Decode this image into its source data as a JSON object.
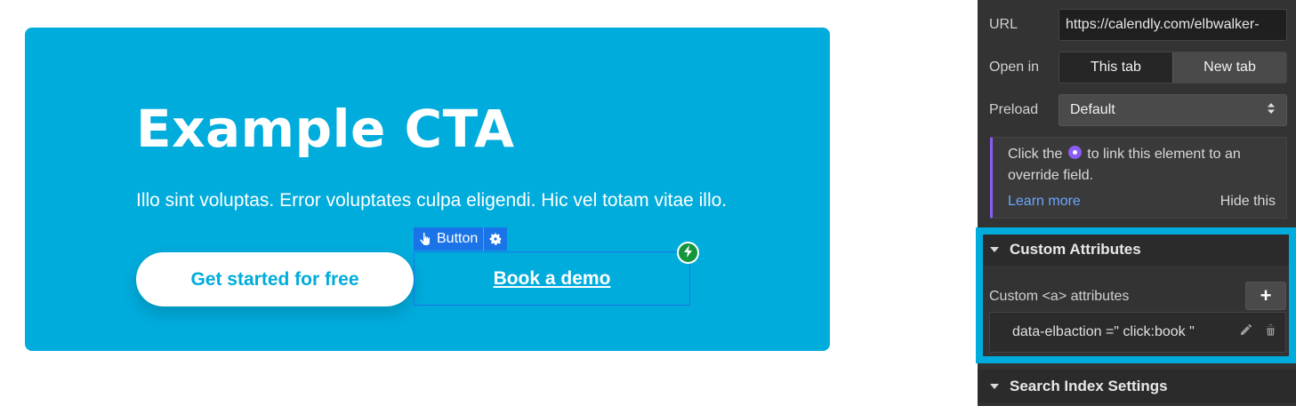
{
  "canvas": {
    "title": "Example CTA",
    "text": "Illo sint voluptas. Error voluptates culpa eligendi. Hic vel totam vitae illo.",
    "primary_button": "Get started for free",
    "link_button": "Book a demo",
    "selection_label": "Button",
    "colors": {
      "cta_bg": "#00acdc",
      "selection": "#1a74e8",
      "badge": "#14963c"
    }
  },
  "panel": {
    "url_label": "URL",
    "url_value": "https://calendly.com/elbwalker-",
    "open_in_label": "Open in",
    "open_in_options": [
      "This tab",
      "New tab"
    ],
    "open_in_selected": "This tab",
    "preload_label": "Preload",
    "preload_value": "Default",
    "notice_before": "Click the",
    "notice_after": "to link this element to an override field.",
    "notice_learn": "Learn more",
    "notice_hide": "Hide this",
    "custom_attributes_title": "Custom Attributes",
    "custom_attr_label": "Custom <a> attributes",
    "attribute": "data-elbaction =\" click:book \"",
    "search_index_title": "Search Index Settings",
    "colors": {
      "panel_bg": "#333333",
      "accent": "#8b5cf6",
      "link": "#6aa6ff",
      "highlight": "#00acdc"
    }
  }
}
